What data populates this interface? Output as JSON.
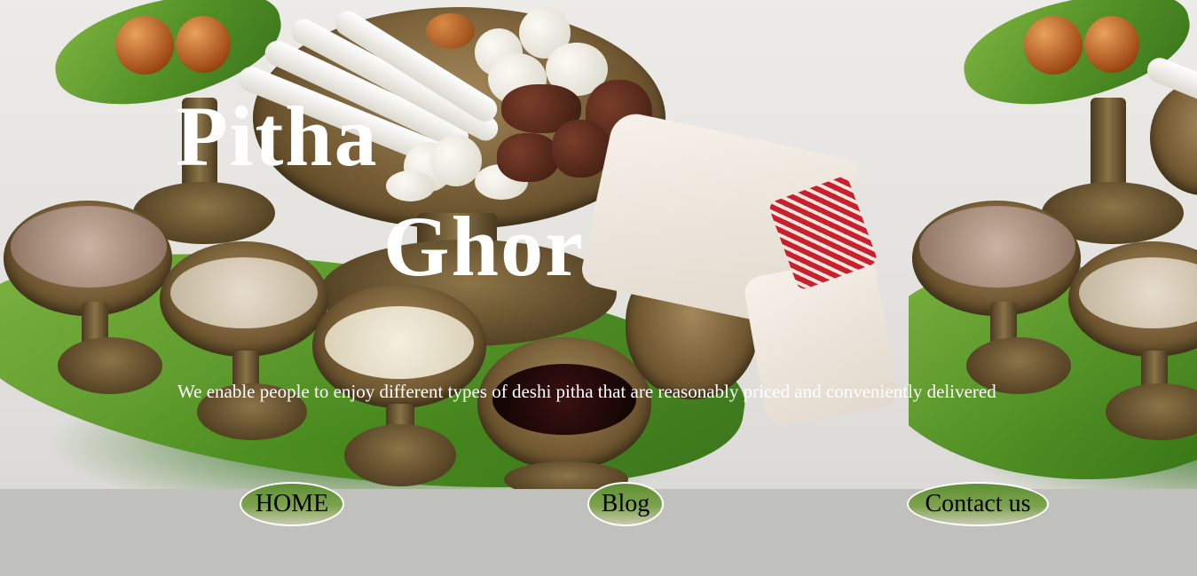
{
  "hero": {
    "title_line1": "Pitha",
    "title_line2": "Ghor",
    "tagline": "We enable people to enjoy different types of deshi pitha that are reasonably priced and conveniently delivered"
  },
  "nav": {
    "home": "HOME",
    "blog": "Blog",
    "contact": "Contact us"
  },
  "colors": {
    "button_gradient_top": "#5e8f34",
    "button_border": "#ffffff",
    "footer_bg": "#c0c0bc",
    "title_color": "#ffffff"
  }
}
